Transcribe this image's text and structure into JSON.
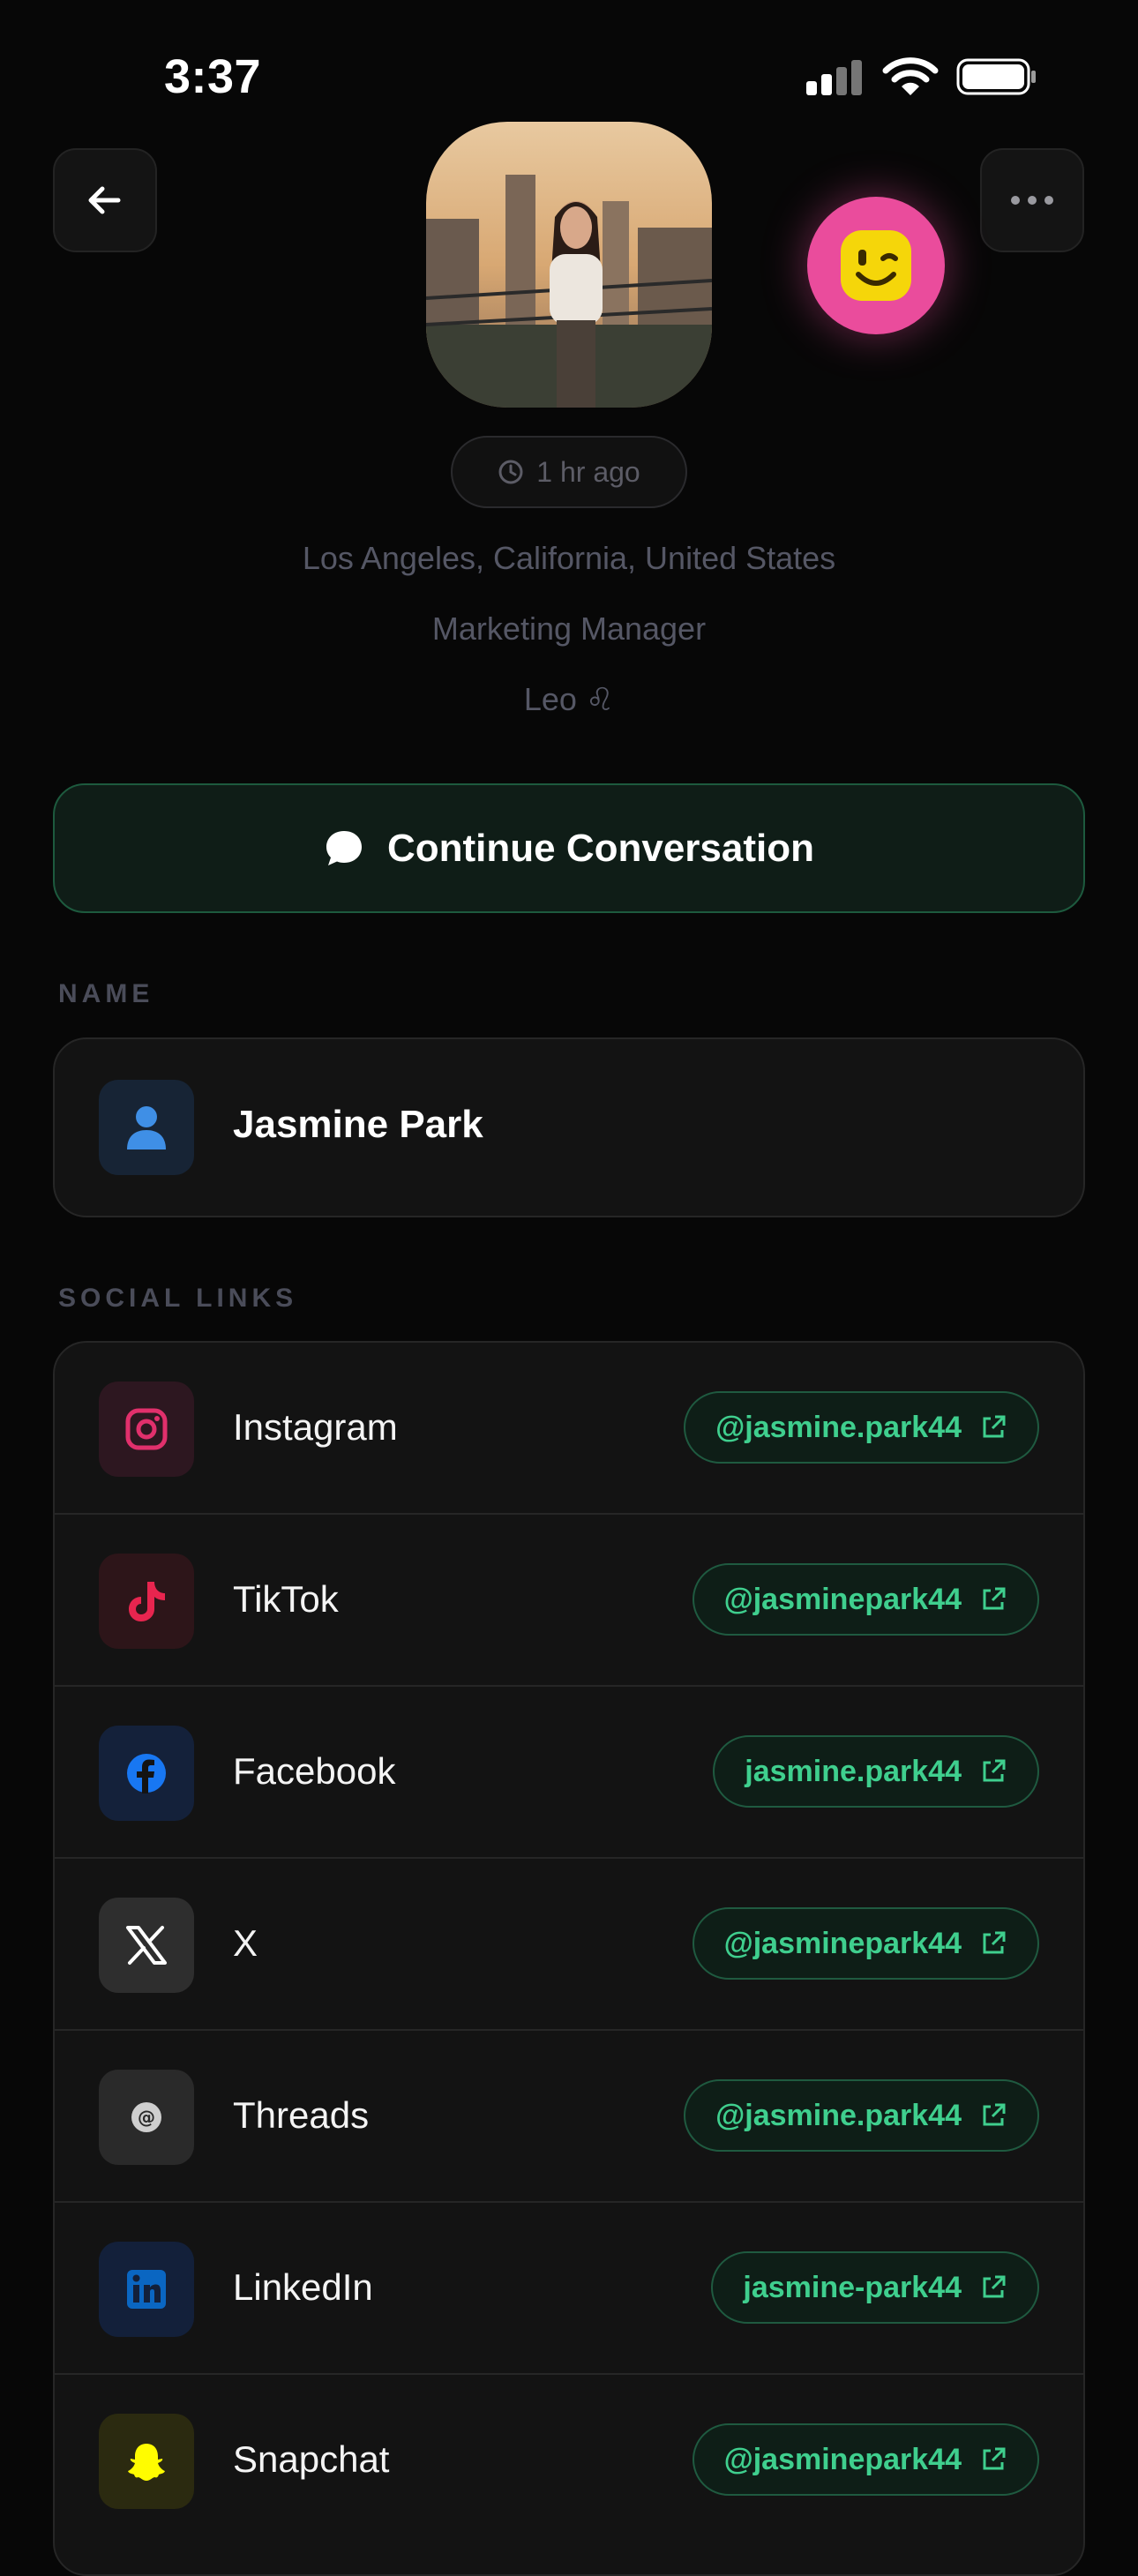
{
  "status_bar": {
    "time": "3:37"
  },
  "profile": {
    "last_seen": "1 hr ago",
    "location": "Los Angeles, California, United States",
    "occupation": "Marketing Manager",
    "zodiac": "Leo ♌",
    "mood_icon": "winking-face-icon"
  },
  "cta": {
    "label": "Continue Conversation",
    "icon": "chat-bubble-icon"
  },
  "name_section": {
    "label": "NAME",
    "value": "Jasmine Park",
    "icon": "person-icon"
  },
  "social_section": {
    "label": "SOCIAL LINKS",
    "items": [
      {
        "platform": "Instagram",
        "handle": "@jasmine.park44",
        "icon": "instagram-icon",
        "color": "#e1306c"
      },
      {
        "platform": "TikTok",
        "handle": "@jasminepark44",
        "icon": "tiktok-icon",
        "color": "#e8254f"
      },
      {
        "platform": "Facebook",
        "handle": "jasmine.park44",
        "icon": "facebook-icon",
        "color": "#1877f2"
      },
      {
        "platform": "X",
        "handle": "@jasminepark44",
        "icon": "x-icon",
        "color": "#ffffff"
      },
      {
        "platform": "Threads",
        "handle": "@jasmine.park44",
        "icon": "threads-icon",
        "color": "#cfcfcf"
      },
      {
        "platform": "LinkedIn",
        "handle": "jasmine-park44",
        "icon": "linkedin-icon",
        "color": "#0a66c2"
      },
      {
        "platform": "Snapchat",
        "handle": "@jasminepark44",
        "icon": "snapchat-icon",
        "color": "#fffc00"
      }
    ]
  },
  "colors": {
    "accent_green": "#3fcf8e",
    "background": "#070707",
    "mood_pink": "#ea4c9c"
  }
}
